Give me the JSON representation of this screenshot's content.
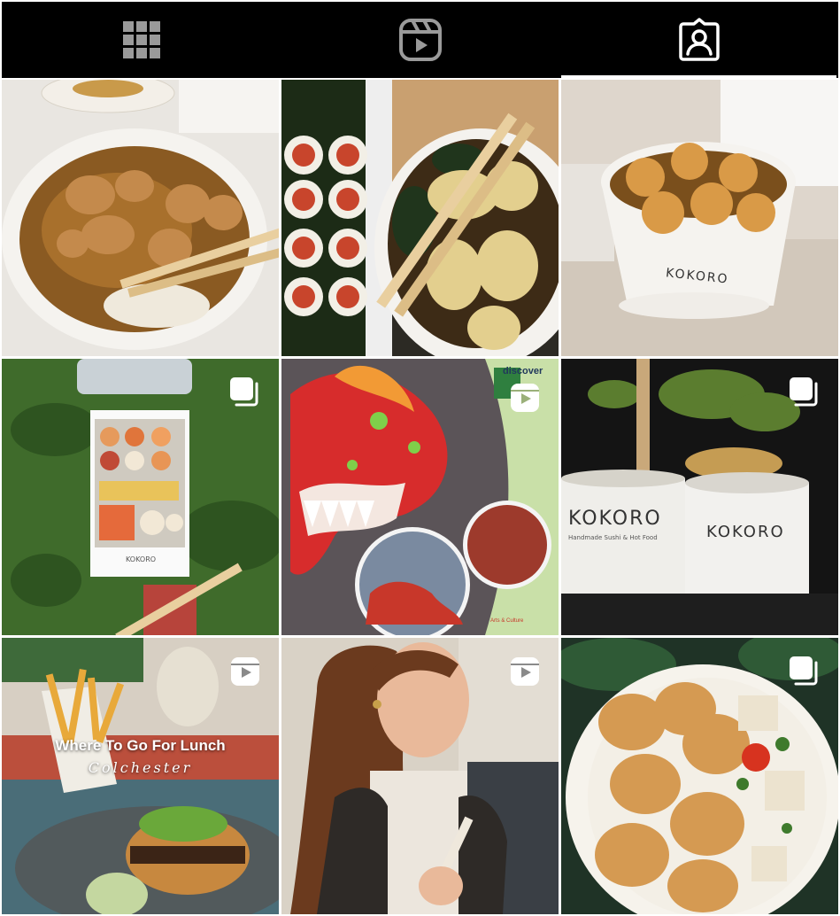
{
  "tabs": [
    {
      "icon": "grid-icon",
      "active": false
    },
    {
      "icon": "reels-icon",
      "active": false
    },
    {
      "icon": "tagged-icon",
      "active": true
    }
  ],
  "posts": [
    {
      "subject": "curry",
      "badge": null
    },
    {
      "subject": "sushi-dumplings",
      "badge": null
    },
    {
      "subject": "kokoro-bowl",
      "badge": null,
      "brand": "KOKORO"
    },
    {
      "subject": "sushi-box-grass",
      "badge": "carousel",
      "brand": "KOKORO"
    },
    {
      "subject": "dragon-discover",
      "badge": "reel",
      "brand": "discover",
      "caption": "Arts & Culture"
    },
    {
      "subject": "kokoro-tubs",
      "badge": "carousel",
      "brand": "KOKORO",
      "tagline": "Handmade Sushi & Hot Food"
    },
    {
      "subject": "lunch-reel",
      "badge": "reel",
      "title": "Where To Go For Lunch",
      "subtitle": "Colchester"
    },
    {
      "subject": "woman-reel",
      "badge": "reel"
    },
    {
      "subject": "tofu-bowl",
      "badge": "carousel"
    }
  ],
  "colors": {
    "tabbar": "#000000",
    "icon": "#9a9a9a",
    "icon_active": "#ffffff"
  }
}
